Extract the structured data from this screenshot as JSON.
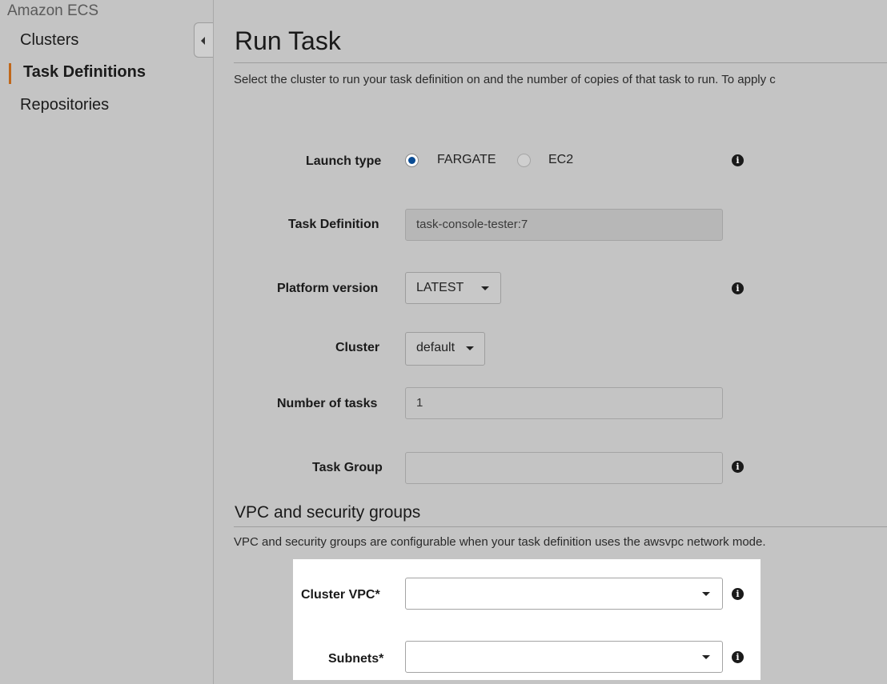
{
  "sidebar": {
    "brand": "Amazon ECS",
    "items": [
      {
        "label": "Clusters",
        "active": false
      },
      {
        "label": "Task Definitions",
        "active": true
      },
      {
        "label": "Repositories",
        "active": false
      }
    ]
  },
  "page": {
    "title": "Run Task",
    "description": "Select the cluster to run your task definition on and the number of copies of that task to run. To apply c"
  },
  "form": {
    "launch_type": {
      "label": "Launch type",
      "options": [
        "FARGATE",
        "EC2"
      ],
      "selected": "FARGATE"
    },
    "task_definition": {
      "label": "Task Definition",
      "value": "task-console-tester:7"
    },
    "platform_version": {
      "label": "Platform version",
      "value": "LATEST"
    },
    "cluster": {
      "label": "Cluster",
      "value": "default"
    },
    "number_of_tasks": {
      "label": "Number of tasks",
      "value": "1"
    },
    "task_group": {
      "label": "Task Group",
      "value": ""
    }
  },
  "vpc_section": {
    "title": "VPC and security groups",
    "description": "VPC and security groups are configurable when your task definition uses the awsvpc network mode.",
    "cluster_vpc": {
      "label": "Cluster VPC*",
      "value": ""
    },
    "subnets": {
      "label": "Subnets*",
      "value": ""
    }
  },
  "icons": {
    "info": "i"
  },
  "colors": {
    "accent": "#c0671a",
    "radio_selected": "#0a4c94",
    "overlay": "#c4c4c4"
  }
}
